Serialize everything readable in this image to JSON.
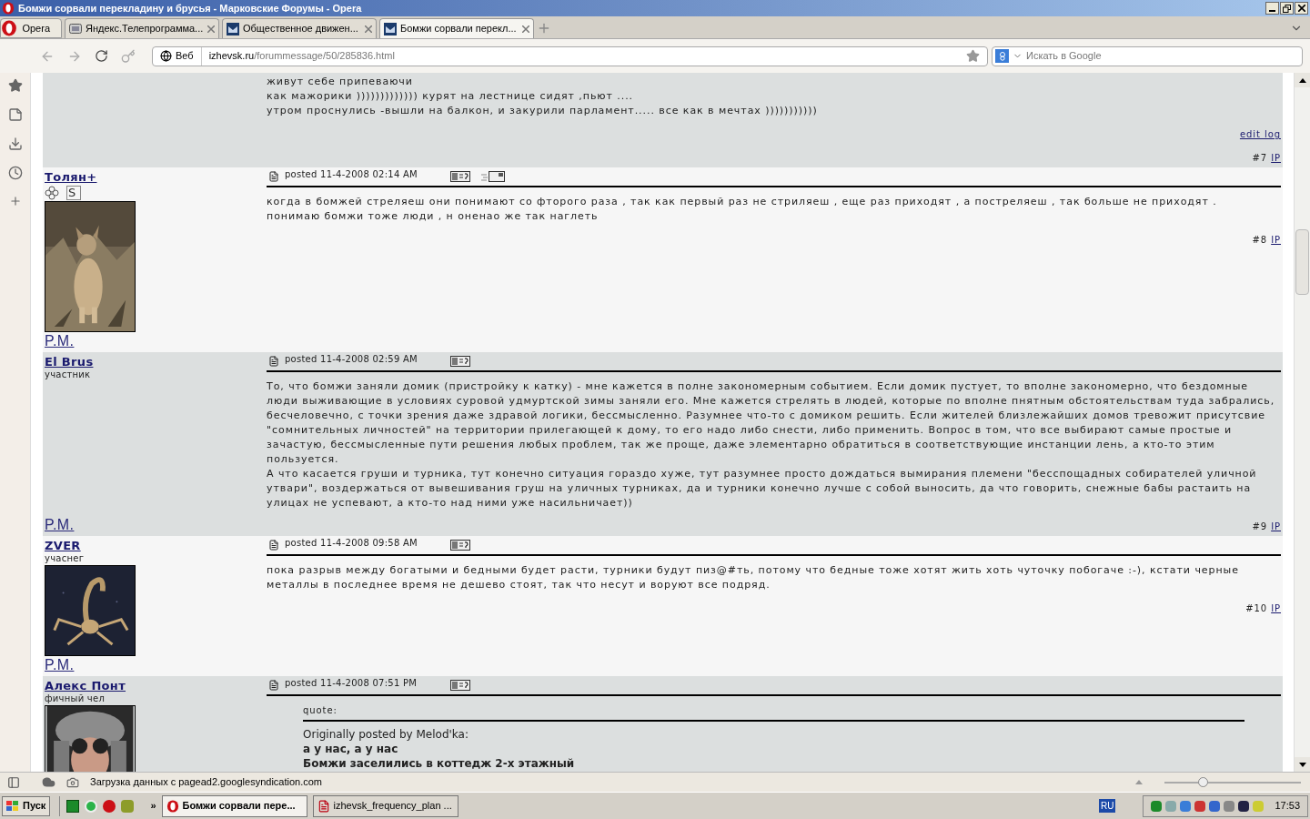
{
  "window": {
    "title": "Бомжи сорвали перекладину и брусья - Марковские Форумы - Opera"
  },
  "menu_button": "Opera",
  "tabs": [
    {
      "label": "Яндекс.Телепрограмма...",
      "kind": "tv",
      "selected": false
    },
    {
      "label": "Общественное движен...",
      "kind": "site",
      "selected": false
    },
    {
      "label": "Бомжи сорвали перекл...",
      "kind": "site",
      "selected": true
    }
  ],
  "address": {
    "badge": "Веб",
    "domain": "izhevsk.ru",
    "path": "/forummessage/50/285836.html"
  },
  "search": {
    "placeholder": "Искать в Google"
  },
  "posts": [
    {
      "shaded": true,
      "lines": [
        "живут себе припеваючи",
        "как мажорики ))))))))))))) курят на лестнице сидят ,пьют ....",
        "утром проснулись -вышли на балкон, и закурили парламент..... все как в мечтах )))))))))))"
      ],
      "edit_log": "edit log",
      "number": "#7",
      "ip": "IP"
    },
    {
      "shaded": false,
      "author": "Толян+",
      "badges": [
        "S"
      ],
      "avatar": {
        "kind": "picture"
      },
      "pm": "P.M.",
      "posted": "posted 11-4-2008 02:14 AM",
      "email_icon": true,
      "lines": [
        "когда в бомжей стреляеш они понимают со фторого раза , так как первый раз не стриляеш , еще раз приходят , а постреляеш , так больше не приходят .",
        "понимаю бомжи тоже люди , н оненао же так наглеть"
      ],
      "number": "#8",
      "ip": "IP"
    },
    {
      "shaded": true,
      "author": "El Brus",
      "rank": "участник",
      "pm": "P.M.",
      "posted": "posted 11-4-2008 02:59 AM",
      "email_icon": false,
      "lines": [
        "То, что бомжи заняли домик (пристройку к катку) - мне кажется в полне закономерным событием. Если домик пустует, то вполне закономерно, что бездомные люди выживающие в условиях суровой удмуртской зимы заняли его. Мне кажется стрелять в людей, которые по вполне пнятным обстоятельствам туда забрались, бесчеловечно, с точки зрения даже здравой логики, бессмысленно. Разумнее что-то с домиком решить. Если жителей близлежайших домов тревожит присутсвие \"сомнительных личностей\" на территории прилегающей к дому, то его надо либо снести, либо применить. Вопрос в том, что все выбирают самые простые и зачастую, бессмысленные пути решения любых проблем, так же проще, даже элементарно обратиться в соответствующие инстанции лень, а кто-то этим пользуется.",
        "А что касается груши и турника, тут конечно ситуация гораздо хуже, тут разумнее просто дождаться вымирания племени \"бесспощадных собирателей уличной утвари\", воздержаться от вывешивания груш на уличных турниках, да и турники конечно лучше с собой выносить, да что говорить, снежные бабы растаить на улицах не успевают, а кто-то над ними уже насильничает))"
      ],
      "number": "#9",
      "ip": "IP"
    },
    {
      "shaded": false,
      "author": "ZVER",
      "rank": "учаснег",
      "avatar": {
        "kind": "picture"
      },
      "pm": "P.M.",
      "posted": "posted 11-4-2008 09:58 AM",
      "email_icon": false,
      "lines": [
        "пока разрыв между богатыми и бедными будет расти, турники будут пиз@#ть, потому что бедные тоже хотят жить хоть чуточку побогаче :-), кстати черные металлы в последнее время не дешево стоят, так что несут и воруют все подряд."
      ],
      "number": "#10",
      "ip": "IP"
    },
    {
      "shaded": true,
      "author": "Алекс Понт",
      "rank": "фичный чел",
      "avatar": {
        "kind": "picture"
      },
      "posted": "posted 11-4-2008 07:51 PM",
      "email_icon": false,
      "quote": {
        "label": "quote:",
        "byline": "Originally posted by Melod'ka:",
        "lines": [
          "а у нас, а у нас",
          "Бомжи заселились в коттедж 2-х этажный"
        ]
      }
    }
  ],
  "status_bar": {
    "text": "Загрузка данных с pagead2.googlesyndication.com",
    "zoom": {
      "level": 0.28
    }
  },
  "taskbar": {
    "start": "Пуск",
    "more": "»",
    "tasks": [
      {
        "label": "Бомжи сорвали пере...",
        "kind": "opera",
        "selected": true
      },
      {
        "label": "izhevsk_frequency_plan ...",
        "kind": "pdf",
        "selected": false
      }
    ],
    "language": "RU",
    "time": "17:53"
  }
}
